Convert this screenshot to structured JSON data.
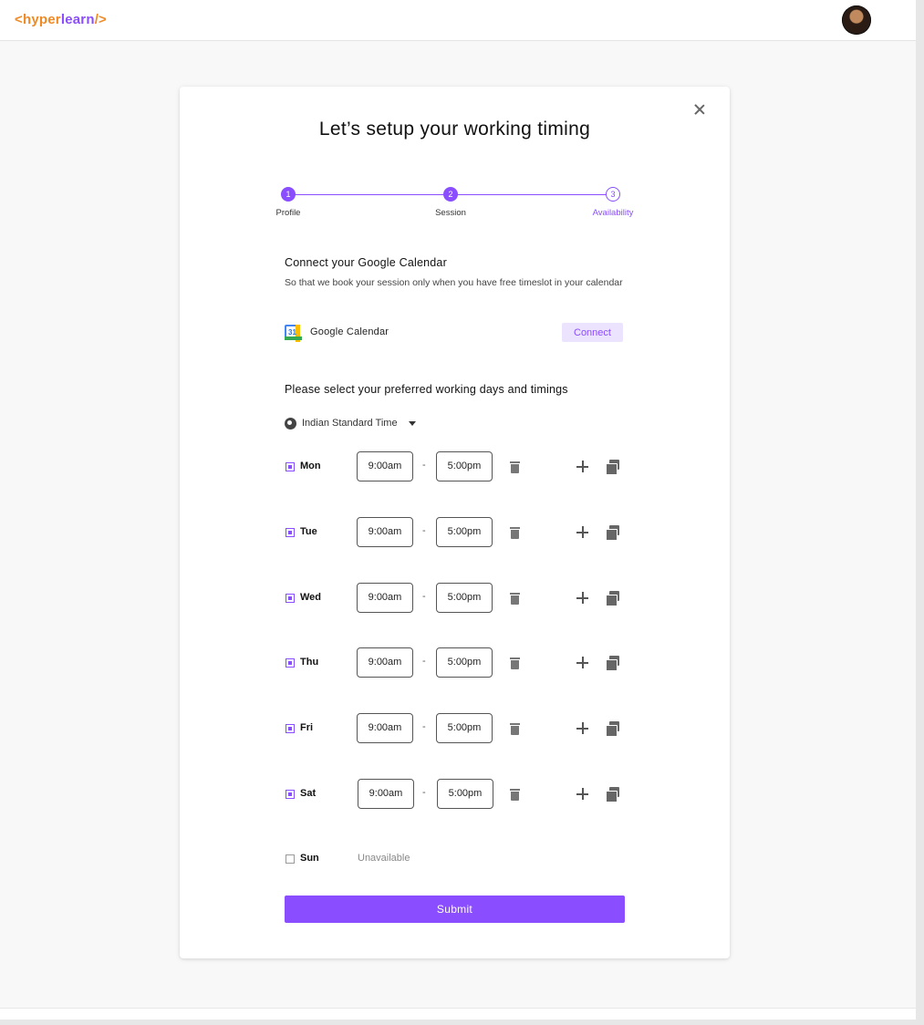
{
  "header": {
    "logo_open": "<",
    "logo_word1": "hyper",
    "logo_word2": "learn",
    "logo_close": "/>"
  },
  "modal": {
    "title": "Let’s setup your working timing",
    "stepper": [
      {
        "number": "1",
        "label": "Profile",
        "state": "done"
      },
      {
        "number": "2",
        "label": "Session",
        "state": "done"
      },
      {
        "number": "3",
        "label": "Availability",
        "state": "current"
      }
    ],
    "calendar": {
      "heading": "Connect your Google Calendar",
      "description": "So that we book your session only when you have free timeslot in your calendar",
      "icon_text": "31",
      "provider": "Google Calendar",
      "connect_label": "Connect"
    },
    "availability": {
      "heading": "Please select your preferred working days and timings",
      "timezone": "Indian Standard Time",
      "days": [
        {
          "day": "Mon",
          "checked": true,
          "start": "9:00am",
          "end": "5:00pm"
        },
        {
          "day": "Tue",
          "checked": true,
          "start": "9:00am",
          "end": "5:00pm"
        },
        {
          "day": "Wed",
          "checked": true,
          "start": "9:00am",
          "end": "5:00pm"
        },
        {
          "day": "Thu",
          "checked": true,
          "start": "9:00am",
          "end": "5:00pm"
        },
        {
          "day": "Fri",
          "checked": true,
          "start": "9:00am",
          "end": "5:00pm"
        },
        {
          "day": "Sat",
          "checked": true,
          "start": "9:00am",
          "end": "5:00pm"
        },
        {
          "day": "Sun",
          "checked": false,
          "status": "Unavailable"
        }
      ],
      "range_separator": "-"
    },
    "submit_label": "Submit"
  },
  "colors": {
    "accent": "#8a4dff",
    "logo_orange": "#f08a24",
    "connect_bg": "#ece4ff"
  }
}
